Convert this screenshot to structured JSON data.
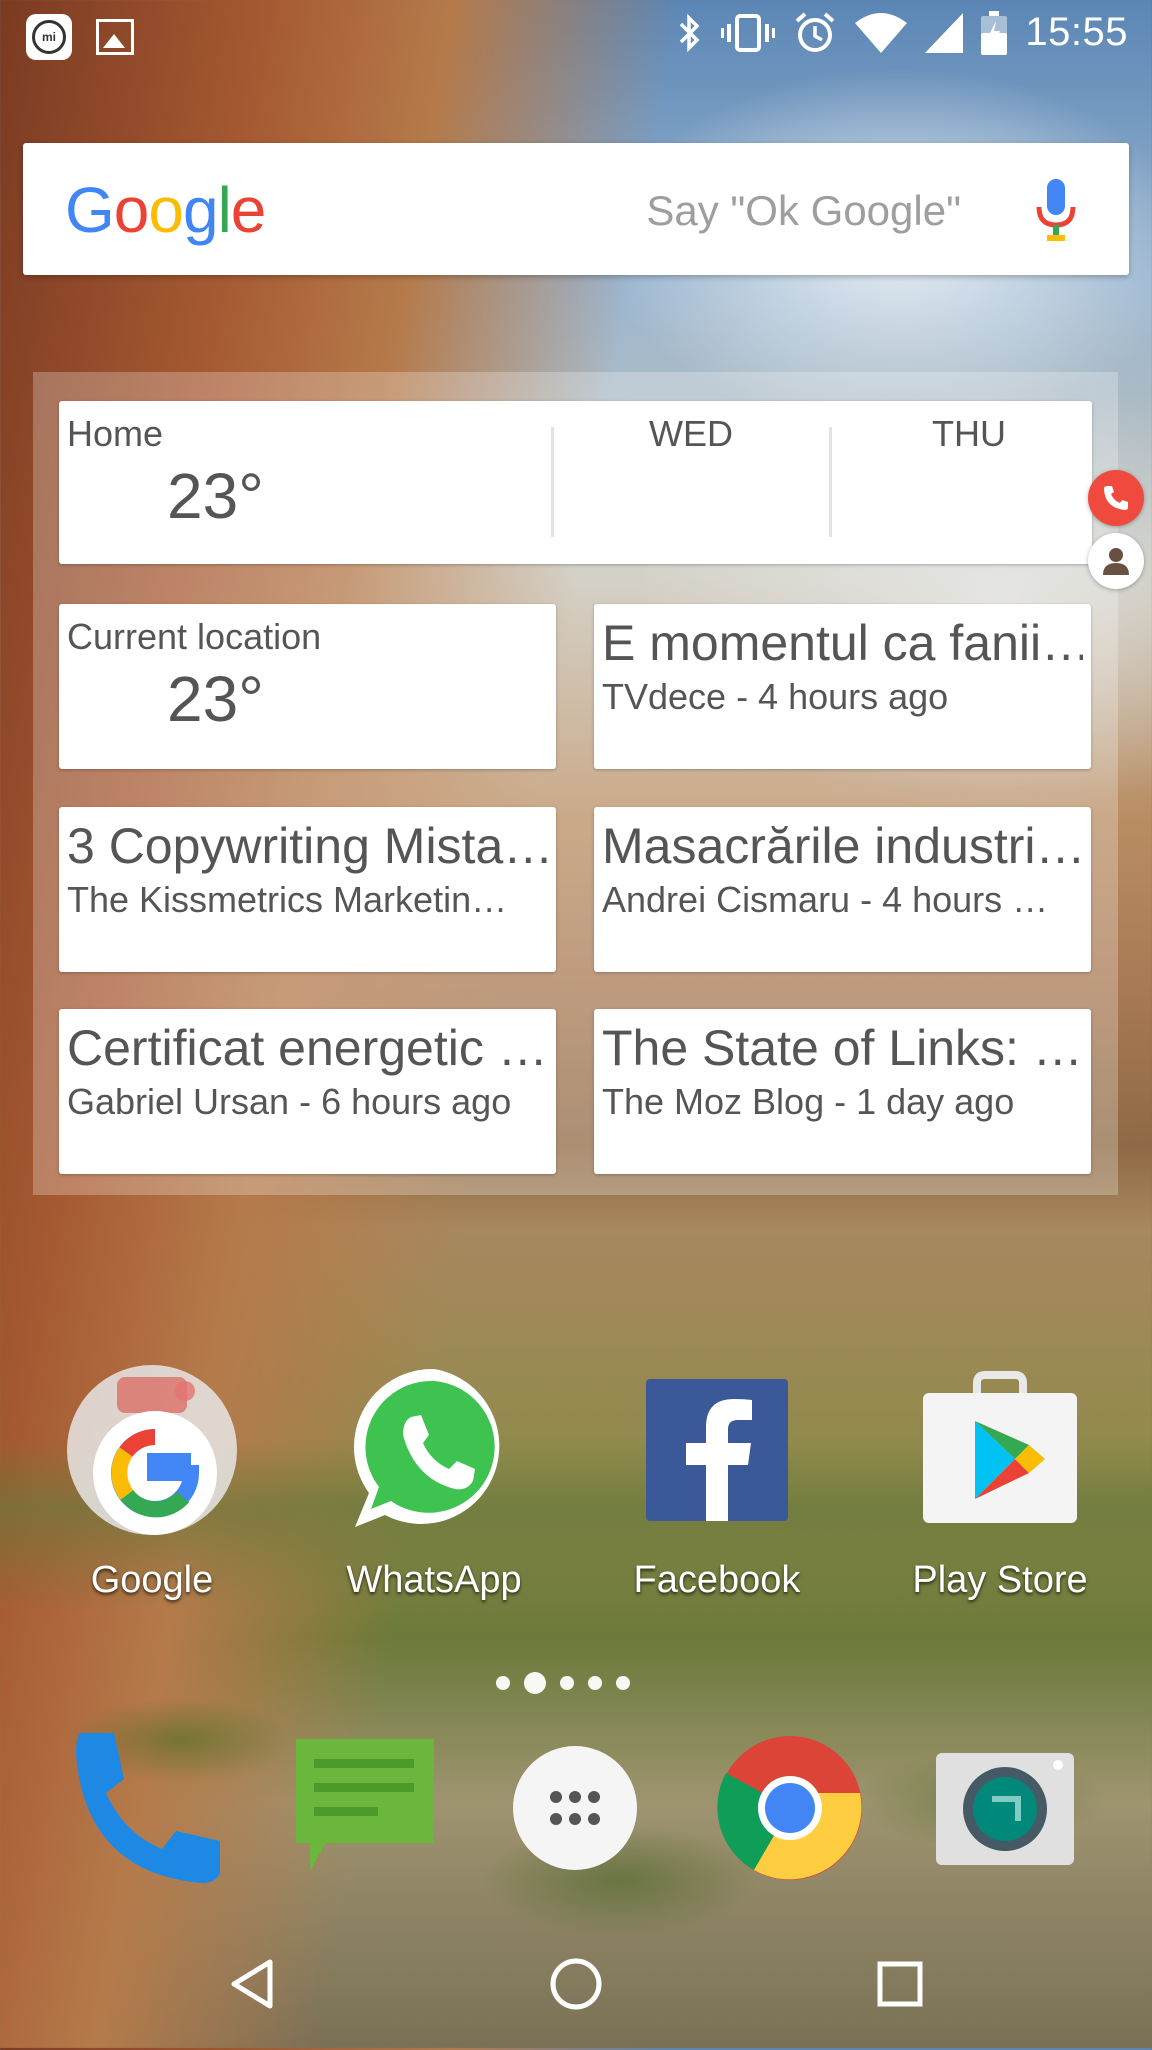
{
  "status_bar": {
    "time": "15:55",
    "icons": [
      "mi-icon",
      "gallery-notification-icon",
      "bluetooth-icon",
      "vibrate-icon",
      "alarm-icon",
      "wifi-icon",
      "cell-signal-icon",
      "battery-charging-icon"
    ]
  },
  "search": {
    "logo": [
      "G",
      "o",
      "o",
      "g",
      "l",
      "e"
    ],
    "logo_colors": [
      "#4285F4",
      "#EA4335",
      "#FBBC05",
      "#4285F4",
      "#34A853",
      "#EA4335"
    ],
    "hint": "Say \"Ok Google\""
  },
  "weather": {
    "home_label": "Home",
    "home_temp": "23°",
    "day1": "WED",
    "day2": "THU",
    "current_label": "Current location",
    "current_temp": "23°"
  },
  "feeds": [
    {
      "title": "E momentul ca fanii…",
      "subtitle": "TVdece - 4 hours ago"
    },
    {
      "title": "3 Copywriting Mista…",
      "subtitle": "The Kissmetrics Marketin…"
    },
    {
      "title": "Masacrările industri…",
      "subtitle": "Andrei Cismaru - 4 hours …"
    },
    {
      "title": "Certificat energetic …",
      "subtitle": "Gabriel Ursan - 6 hours ago"
    },
    {
      "title": "The State of Links: …",
      "subtitle": "The Moz Blog - 1 day ago"
    }
  ],
  "apps": [
    {
      "label": "Google"
    },
    {
      "label": "WhatsApp"
    },
    {
      "label": "Facebook"
    },
    {
      "label": "Play Store"
    }
  ],
  "pages": {
    "count": 5,
    "active": 1
  },
  "dock": [
    "phone-icon",
    "messages-icon",
    "app-drawer-icon",
    "chrome-icon",
    "camera-icon"
  ],
  "nav": [
    "back-icon",
    "home-icon",
    "recents-icon"
  ]
}
